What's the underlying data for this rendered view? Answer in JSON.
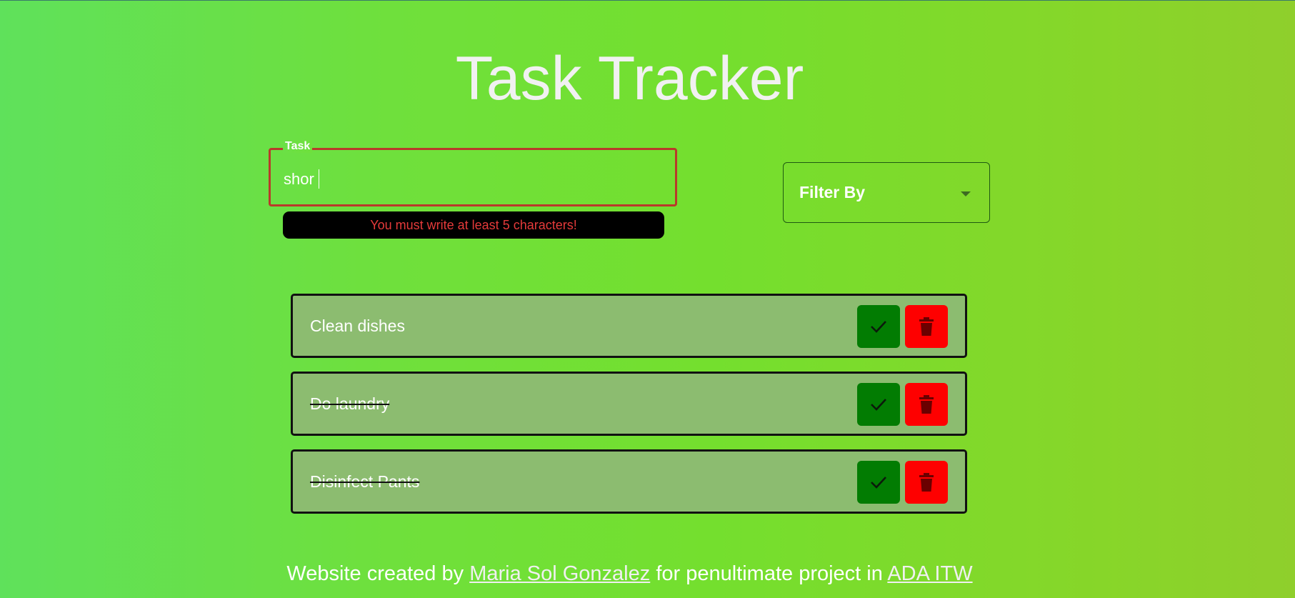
{
  "page": {
    "title": "Task Tracker"
  },
  "task_form": {
    "legend": "Task",
    "input_value": "shor",
    "error_message": "You must write at least 5 characters!"
  },
  "filter": {
    "label": "Filter By"
  },
  "tasks": [
    {
      "text": "Clean dishes",
      "completed": false
    },
    {
      "text": "Do laundry",
      "completed": true
    },
    {
      "text": "Disinfect Pants",
      "completed": true
    }
  ],
  "footer": {
    "prefix": "Website created by",
    "author_link": "Maria Sol Gonzalez",
    "middle": "for penultimate project in",
    "org_link": "ADA ITW"
  },
  "icons": {
    "complete": "check-icon",
    "delete": "trash-icon",
    "dropdown": "caret-down-icon"
  },
  "colors": {
    "complete_button": "#027c02",
    "delete_button": "#fe0000",
    "error_text": "#e53a3a",
    "card_background": "#8cbc70"
  }
}
